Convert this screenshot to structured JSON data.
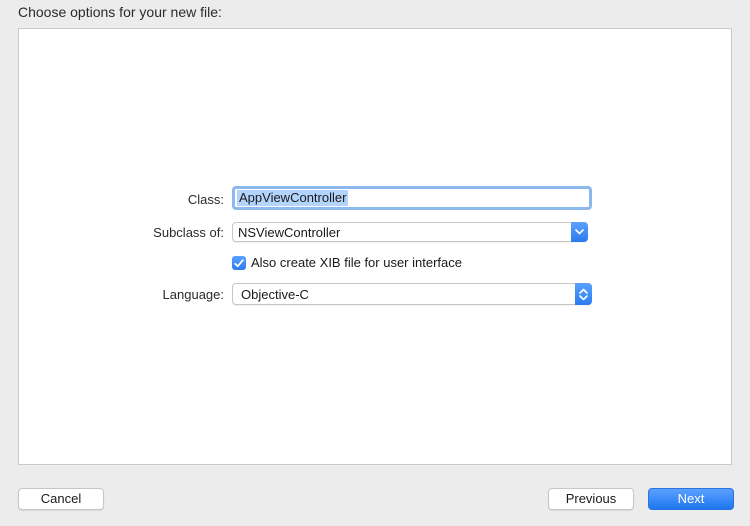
{
  "header": {
    "title": "Choose options for your new file:"
  },
  "form": {
    "class_label": "Class:",
    "class_value": "AppViewController",
    "subclass_label": "Subclass of:",
    "subclass_value": "NSViewController",
    "checkbox_label": "Also create XIB file for user interface",
    "checkbox_checked": true,
    "language_label": "Language:",
    "language_value": "Objective-C"
  },
  "footer": {
    "cancel_label": "Cancel",
    "previous_label": "Previous",
    "next_label": "Next"
  },
  "colors": {
    "accent": "#2b7cf0",
    "selection": "#b3d4fc",
    "focus_ring": "#8db8ec"
  },
  "icons": {
    "subclass_dropdown": "chevron-down-icon",
    "language_dropdown": "updown-chevron-icon",
    "checkbox": "checkmark-icon"
  }
}
